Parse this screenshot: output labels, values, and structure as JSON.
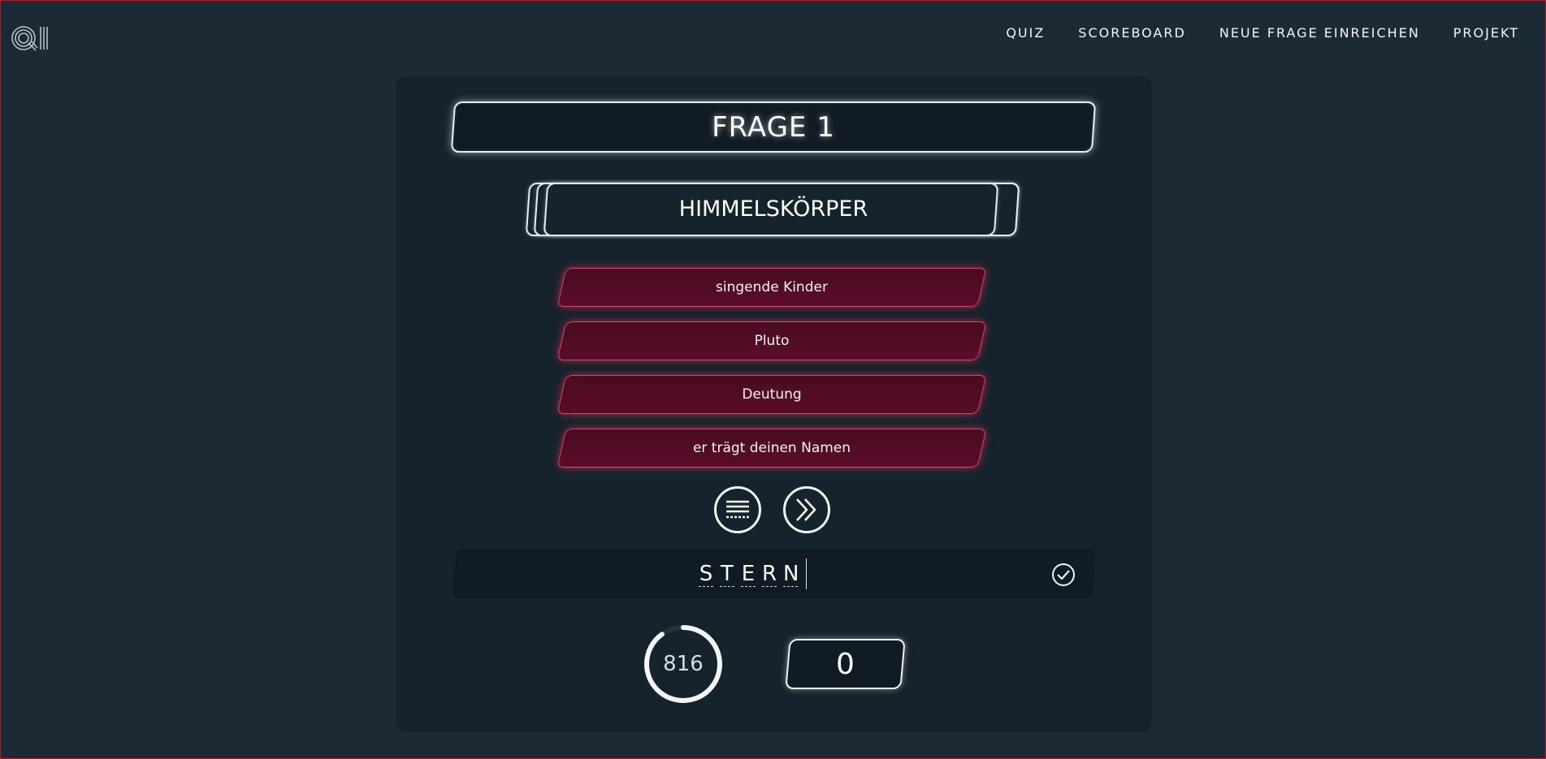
{
  "nav": {
    "items": [
      {
        "label": "QUIZ"
      },
      {
        "label": "SCOREBOARD"
      },
      {
        "label": "NEUE FRAGE EINREICHEN"
      },
      {
        "label": "PROJEKT"
      }
    ]
  },
  "logo": {
    "icon": "qi-logo-icon"
  },
  "question": {
    "title": "FRAGE 1",
    "category": "HIMMELSKÖRPER",
    "hints": [
      "singende Kinder",
      "Pluto",
      "Deutung",
      "er trägt deinen Namen"
    ]
  },
  "controls": {
    "list_icon": "list-icon",
    "skip_icon": "double-chevron-right-icon",
    "submit_icon": "check-circle-icon"
  },
  "answer": {
    "letters": [
      "S",
      "T",
      "E",
      "R",
      "N"
    ]
  },
  "status": {
    "timer": "816",
    "timer_fraction": 0.9,
    "score": "0"
  },
  "colors": {
    "background": "#1b2a35",
    "panel": "#15232d",
    "hint_fill": "#52102a",
    "hint_glow": "#e12850"
  }
}
